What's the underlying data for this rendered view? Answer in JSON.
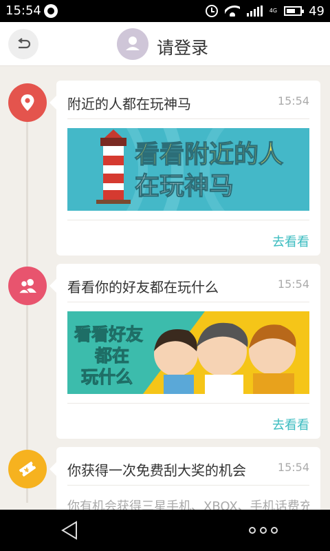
{
  "status_bar": {
    "time": "15:54",
    "network_label": "4G",
    "battery": "49"
  },
  "header": {
    "login_label": "请登录"
  },
  "feed": [
    {
      "title": "附近的人都在玩神马",
      "time": "15:54",
      "banner_text_line1": "看看附近的人",
      "banner_text_line2": "在玩神马",
      "link": "去看看",
      "icon": "location-pin-icon",
      "color": "#e4544d"
    },
    {
      "title": "看看你的好友都在玩什么",
      "time": "15:54",
      "banner_text_line1": "看看好友",
      "banner_text_line2": "都在",
      "banner_text_line3": "玩什么",
      "link": "去看看",
      "icon": "friends-icon",
      "color": "#e8546e"
    },
    {
      "title": "你获得一次免费刮大奖的机会",
      "time": "15:54",
      "description": "你有机会获得三星手机、XBOX、手机话费充",
      "icon": "lottery-ticket-icon",
      "color": "#f6b21f"
    }
  ],
  "colors": {
    "accent": "#3cbcc0",
    "background": "#f2efea"
  }
}
